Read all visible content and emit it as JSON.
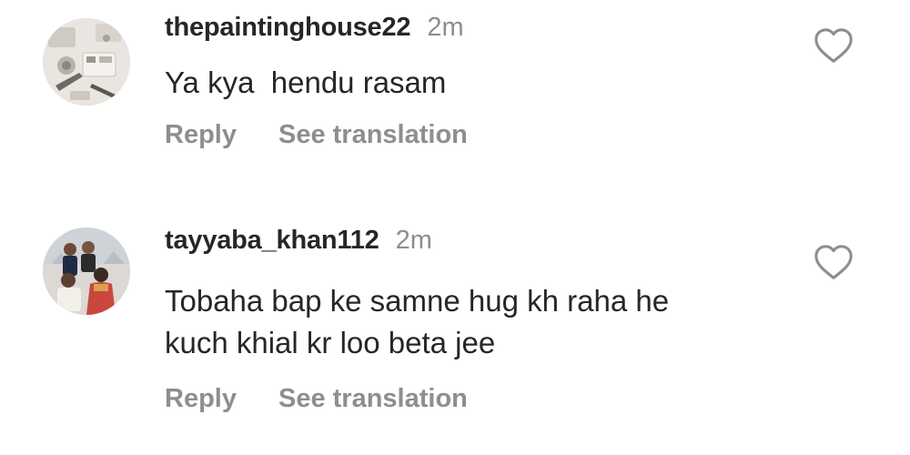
{
  "comments": [
    {
      "username": "thepaintinghouse22",
      "time": "2m",
      "lines": [
        "Ya kya  hendu rasam"
      ],
      "reply_label": "Reply",
      "translate_label": "See translation",
      "avatar_icon": "paint-supplies-avatar",
      "like_icon": "heart-outline-icon"
    },
    {
      "username": "tayyaba_khan112",
      "time": "2m",
      "lines": [
        "Tobaha bap ke samne hug kh raha he",
        "kuch khial kr loo beta jee"
      ],
      "reply_label": "Reply",
      "translate_label": "See translation",
      "avatar_icon": "family-photo-avatar",
      "like_icon": "heart-outline-icon"
    }
  ],
  "colors": {
    "text_primary": "#262626",
    "text_secondary": "#8e8e8e",
    "background": "#ffffff"
  }
}
